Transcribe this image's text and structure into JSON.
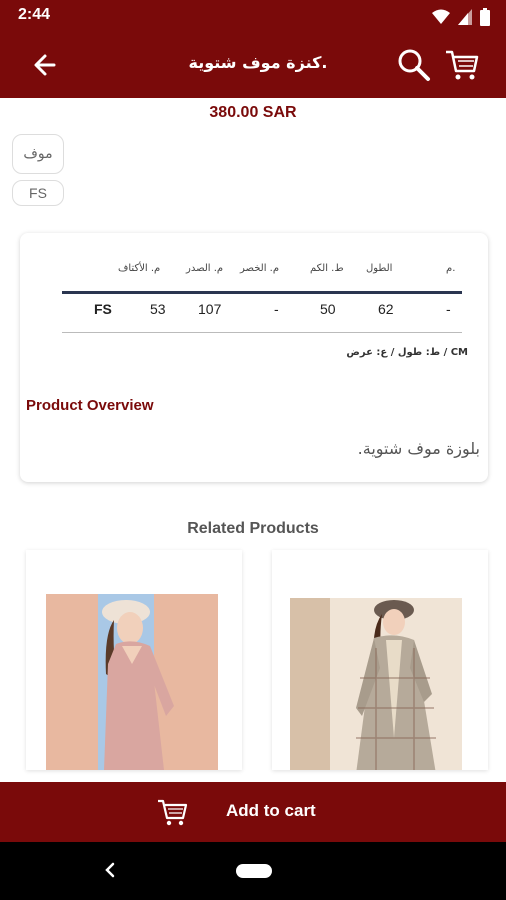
{
  "status_bar": {
    "time": "2:44"
  },
  "app_bar": {
    "title": "كنزة موف شتوية."
  },
  "product": {
    "price": "380.00 SAR",
    "color_option": "موف",
    "size_option": "FS"
  },
  "size_table": {
    "headers": [
      "م. الأكتاف",
      "م. الصدر",
      "م. الخصر",
      "ط. الكم",
      "الطول",
      "م."
    ],
    "row": [
      "FS",
      "53",
      "107",
      "-",
      "50",
      "62",
      "-"
    ],
    "note": "ط: طول / ع: عرض / CM"
  },
  "overview": {
    "title": "Product Overview",
    "text": "بلوزة موف شتوية."
  },
  "related": {
    "title": "Related Products"
  },
  "add_to_cart": {
    "label": "Add to cart"
  },
  "colors": {
    "brand": "#7a0a0a",
    "table_rule": "#2a3550"
  }
}
